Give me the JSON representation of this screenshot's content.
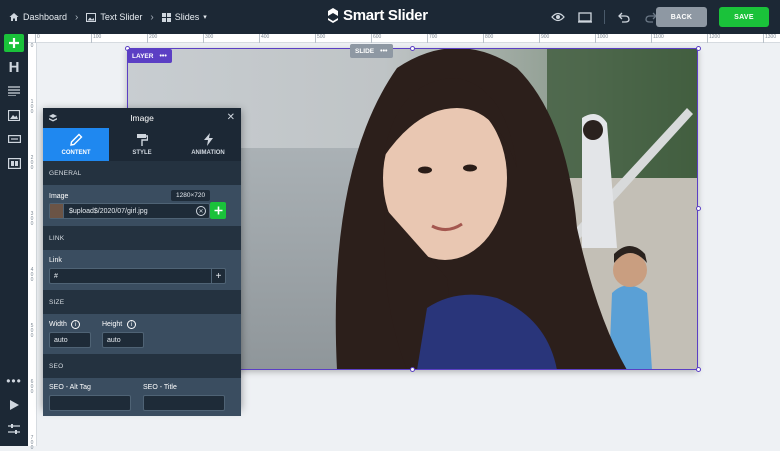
{
  "topbar": {
    "dashboard": "Dashboard",
    "text_slider": "Text Slider",
    "slides": "Slides",
    "logo": "Smart Slider",
    "back_label": "BACK",
    "save_label": "SAVE"
  },
  "rulers": {
    "horizontal": [
      "0",
      "100",
      "200",
      "300",
      "400",
      "500",
      "600",
      "700",
      "800",
      "900",
      "1000",
      "1100",
      "1200",
      "1300"
    ],
    "vertical": [
      "0",
      "100",
      "200",
      "300",
      "400",
      "500",
      "600",
      "700"
    ]
  },
  "stage": {
    "slide_label": "SLIDE",
    "layer_label": "LAYER"
  },
  "panel": {
    "title": "Image",
    "tabs": [
      "CONTENT",
      "STYLE",
      "ANIMATION"
    ],
    "sections": {
      "general": "GENERAL",
      "link": "LINK",
      "size": "SIZE",
      "seo": "SEO"
    },
    "image_label": "Image",
    "image_dimensions": "1280×720",
    "image_path": "$upload$/2020/07/girl.jpg",
    "link_label": "Link",
    "link_value": "#",
    "width_label": "Width",
    "width_value": "auto",
    "height_label": "Height",
    "height_value": "auto",
    "seo_alt_label": "SEO - Alt Tag",
    "seo_title_label": "SEO - Title"
  },
  "colors": {
    "dark": "#1c2835",
    "accent_blue": "#1f88f0",
    "green": "#1ac23a",
    "purple": "#5b3fc4"
  }
}
